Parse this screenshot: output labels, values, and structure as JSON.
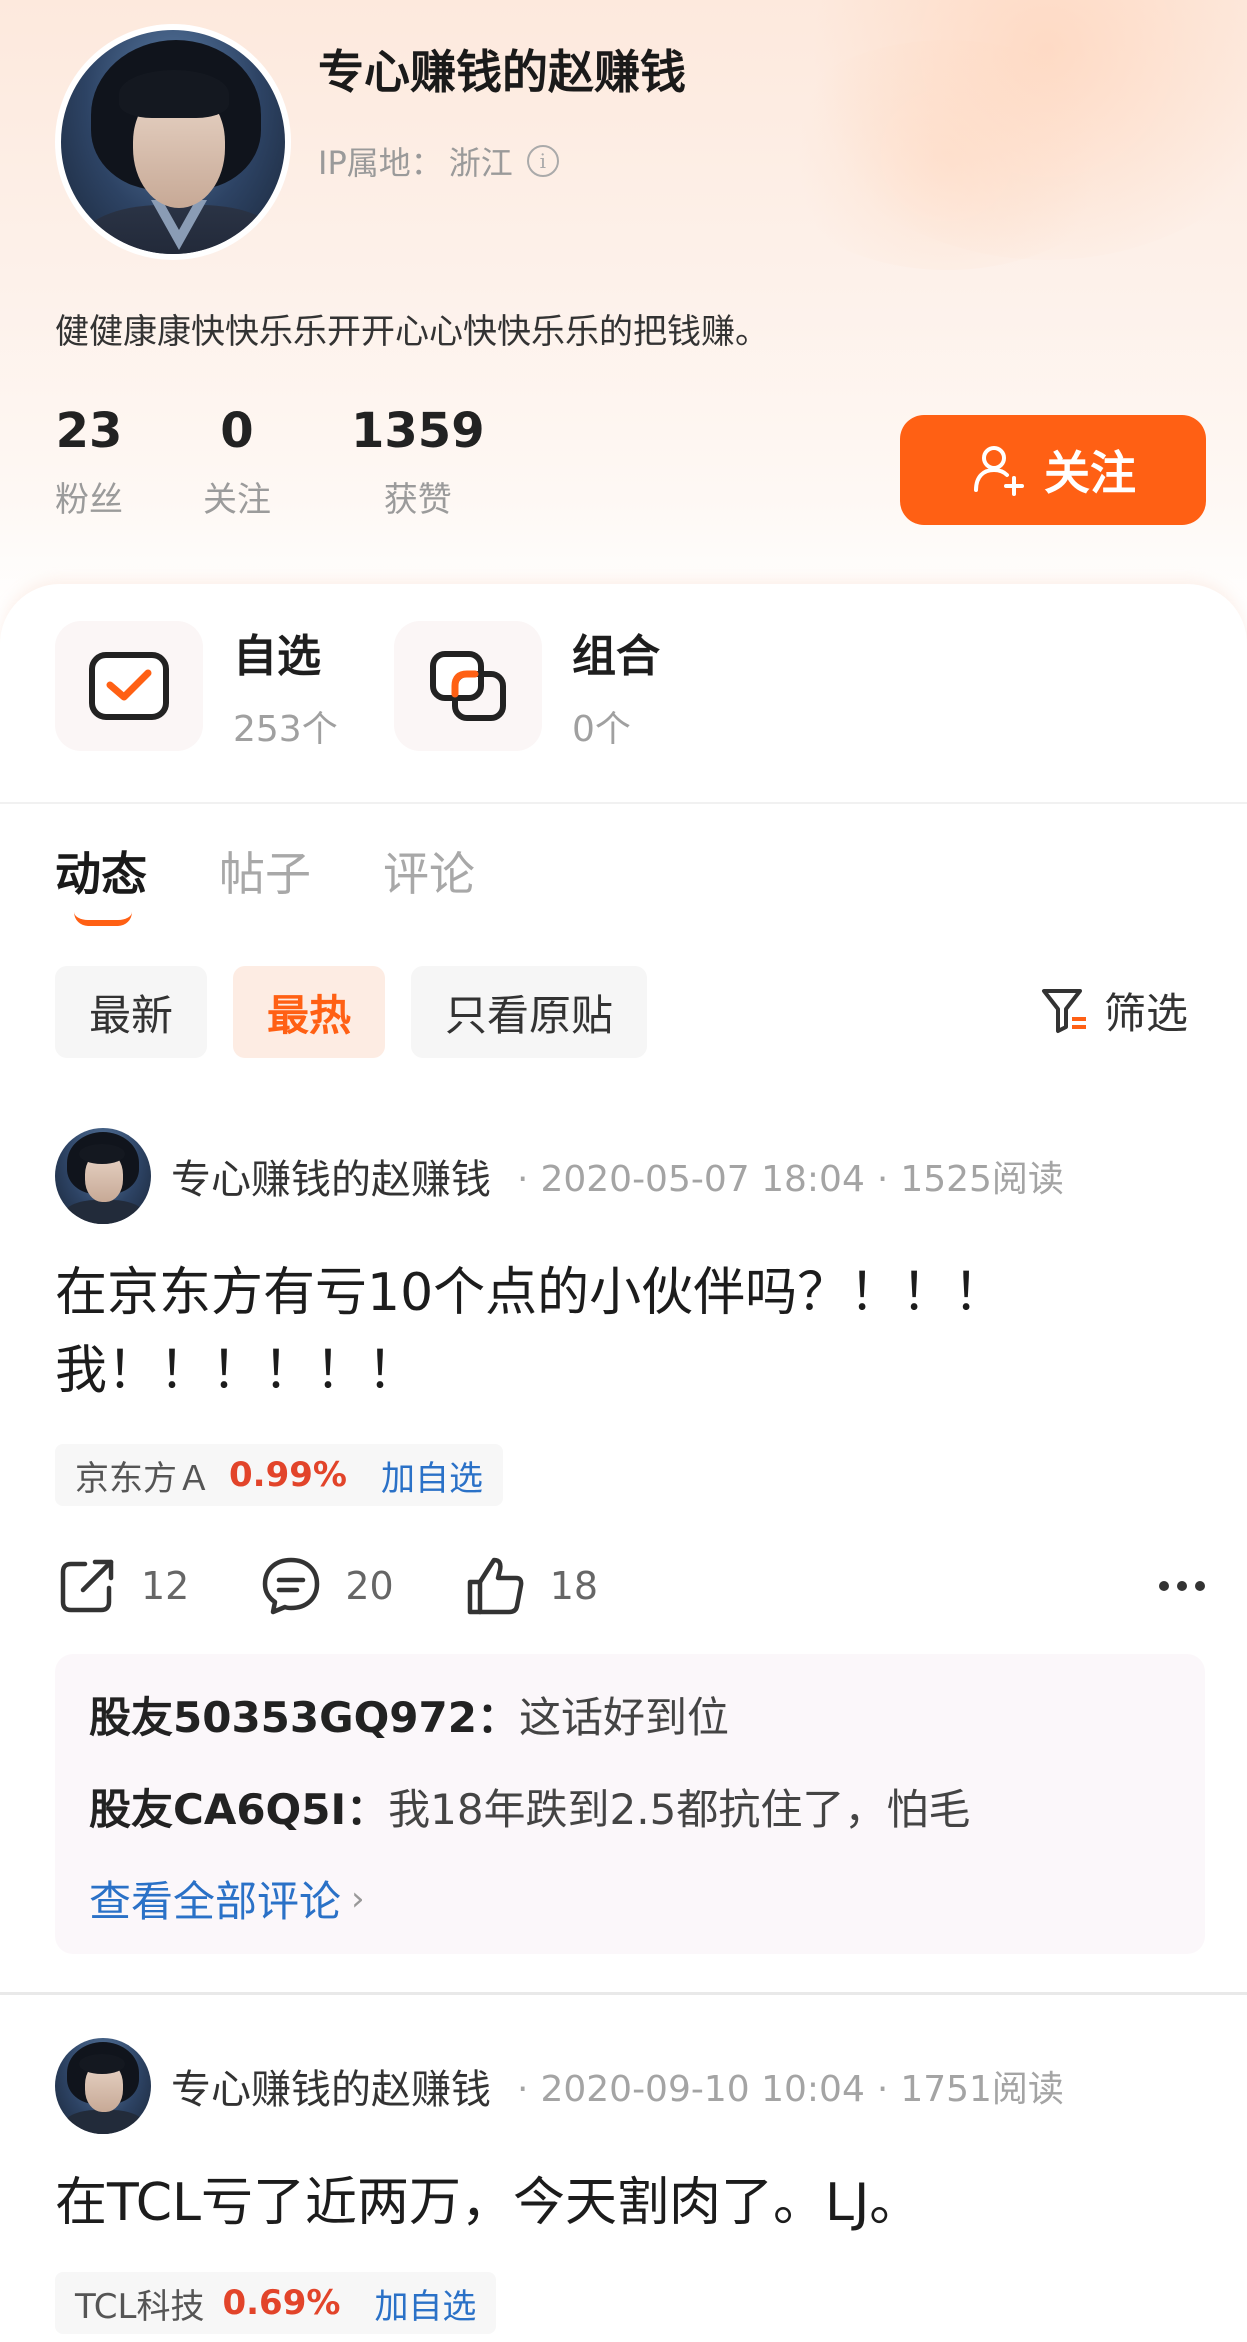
{
  "profile": {
    "username": "专心赚钱的赵赚钱",
    "ip_label": "IP属地：",
    "ip_value": "浙江",
    "bio": "健健康康快快乐乐开开心心快快乐乐的把钱赚。",
    "stats": [
      {
        "num": "23",
        "label": "粉丝"
      },
      {
        "num": "0",
        "label": "关注"
      },
      {
        "num": "1359",
        "label": "获赞"
      }
    ],
    "follow_label": "关注"
  },
  "quick": [
    {
      "title": "自选",
      "sub": "253个"
    },
    {
      "title": "组合",
      "sub": "0个"
    }
  ],
  "tabs": [
    "动态",
    "帖子",
    "评论"
  ],
  "filters": [
    "最新",
    "最热",
    "只看原贴"
  ],
  "filter_right_label": "筛选",
  "posts": [
    {
      "author": "专心赚钱的赵赚钱",
      "date": "2020-05-07 18:04",
      "reads": "1525阅读",
      "body_line1": "在京东方有亏10个点的小伙伴吗？！！！",
      "body_line2": "我！！！！！！",
      "stock": {
        "name": "京东方Ａ",
        "pct": "0.99%",
        "add": "加自选"
      },
      "shares": "12",
      "comments_count": "20",
      "likes": "18",
      "comments": [
        {
          "user": "股友50353GQ972：",
          "text": "这话好到位"
        },
        {
          "user": "股友CA6Q5I：",
          "text": "我18年跌到2.5都抗住了，怕毛"
        }
      ],
      "view_all": "查看全部评论"
    },
    {
      "author": "专心赚钱的赵赚钱",
      "date": "2020-09-10 10:04",
      "reads": "1751阅读",
      "body_line1": "在TCL亏了近两万，今天割肉了。LJ。",
      "stock": {
        "name": "TCL科技",
        "pct": "0.69%",
        "add": "加自选"
      }
    }
  ],
  "colors": {
    "accent": "#ff6014",
    "link": "#2a71c7",
    "up": "#e2442a"
  }
}
